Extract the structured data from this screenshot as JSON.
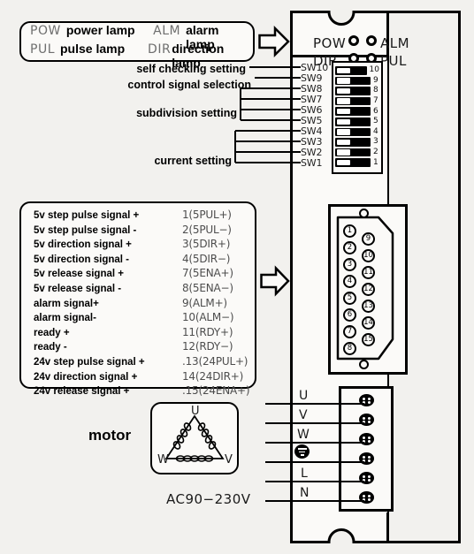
{
  "legend": {
    "lamps": [
      {
        "abbr": "POW",
        "name": "power lamp"
      },
      {
        "abbr": "ALM",
        "name": "alarm lamp"
      },
      {
        "abbr": "PUL",
        "name": "pulse lamp"
      },
      {
        "abbr": "DIR",
        "name": "direction lamp"
      }
    ]
  },
  "leds": [
    {
      "label": "POW",
      "side": "left",
      "row": 0
    },
    {
      "label": "ALM",
      "side": "right",
      "row": 0
    },
    {
      "label": "DIR",
      "side": "left",
      "row": 1
    },
    {
      "label": "PUL",
      "side": "right",
      "row": 1
    }
  ],
  "dip": {
    "switches": [
      {
        "name": "SW10",
        "number": "10"
      },
      {
        "name": "SW9",
        "number": "9"
      },
      {
        "name": "SW8",
        "number": "8"
      },
      {
        "name": "SW7",
        "number": "7"
      },
      {
        "name": "SW6",
        "number": "6"
      },
      {
        "name": "SW5",
        "number": "5"
      },
      {
        "name": "SW4",
        "number": "4"
      },
      {
        "name": "SW3",
        "number": "3"
      },
      {
        "name": "SW2",
        "number": "2"
      },
      {
        "name": "SW1",
        "number": "1"
      }
    ],
    "callouts": [
      {
        "label": "self checking setting"
      },
      {
        "label": "control signal selection"
      },
      {
        "label": "subdivision setting"
      },
      {
        "label": "current setting"
      }
    ]
  },
  "signals": [
    {
      "name": "5v step pulse signal +",
      "pin": "1(5PUL+)"
    },
    {
      "name": "5v step pulse signal -",
      "pin": "2(5PUL−)"
    },
    {
      "name": "5v direction signal +",
      "pin": "3(5DIR+)"
    },
    {
      "name": "5v direction signal -",
      "pin": "4(5DIR−)"
    },
    {
      "name": "5v release signal +",
      "pin": "7(5ENA+)"
    },
    {
      "name": "5v release signal -",
      "pin": "8(5ENA−)"
    },
    {
      "name": "alarm signal+",
      "pin": "9(ALM+)"
    },
    {
      "name": "alarm signal-",
      "pin": "10(ALM−)"
    },
    {
      "name": "ready +",
      "pin": "11(RDY+)"
    },
    {
      "name": "ready -",
      "pin": "12(RDY−)"
    },
    {
      "name": "24v step pulse signal +",
      "pin": ".13(24PUL+)"
    },
    {
      "name": "24v direction signal +",
      "pin": "14(24DIR+)"
    },
    {
      "name": "24v release signal +",
      "pin": ".15(24ENA+)"
    }
  ],
  "connector": {
    "left_pins": [
      "1",
      "2",
      "3",
      "4",
      "5",
      "6",
      "7",
      "8"
    ],
    "right_pins": [
      "9",
      "10",
      "11",
      "12",
      "13",
      "14",
      "15"
    ]
  },
  "terminals": [
    {
      "label": "U",
      "type": "text"
    },
    {
      "label": "V",
      "type": "text"
    },
    {
      "label": "W",
      "type": "text"
    },
    {
      "label": "",
      "type": "ground-icon"
    },
    {
      "label": "L",
      "type": "text"
    },
    {
      "label": "N",
      "type": "text"
    }
  ],
  "motor": {
    "title": "motor",
    "nodes": [
      "U",
      "W",
      "V"
    ]
  },
  "power": {
    "label": "AC90−230V"
  }
}
